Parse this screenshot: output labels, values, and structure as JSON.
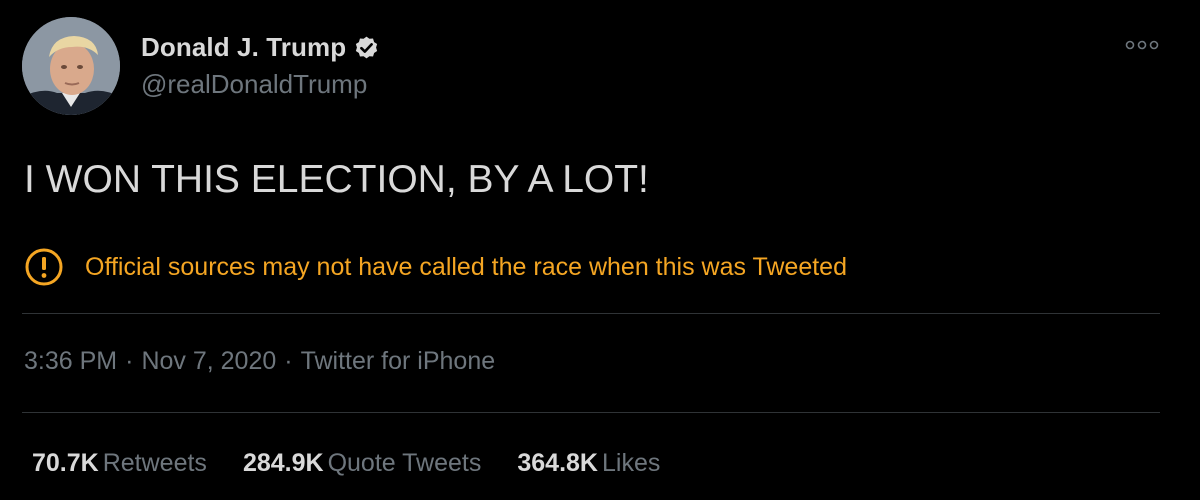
{
  "author": {
    "display_name": "Donald J. Trump",
    "handle": "@realDonaldTrump",
    "verified_icon": "verified-badge-icon",
    "avatar": "profile-photo"
  },
  "more_icon": "more-options-icon",
  "tweet": {
    "text": "I WON THIS ELECTION, BY A LOT!"
  },
  "notice": {
    "icon": "warning-exclamation-icon",
    "text": "Official sources may not have called the race when this was Tweeted",
    "color": "#f5a623"
  },
  "meta": {
    "time": "3:36 PM",
    "separator": "·",
    "date": "Nov 7, 2020",
    "source": "Twitter for iPhone"
  },
  "stats": {
    "retweets": {
      "count": "70.7K",
      "label": "Retweets"
    },
    "quote_tweets": {
      "count": "284.9K",
      "label": "Quote Tweets"
    },
    "likes": {
      "count": "364.8K",
      "label": "Likes"
    }
  },
  "colors": {
    "background": "#000000",
    "primary_text": "#d9d9d9",
    "secondary_text": "#6e767d",
    "warning": "#f5a623",
    "divider": "#2f3336"
  }
}
